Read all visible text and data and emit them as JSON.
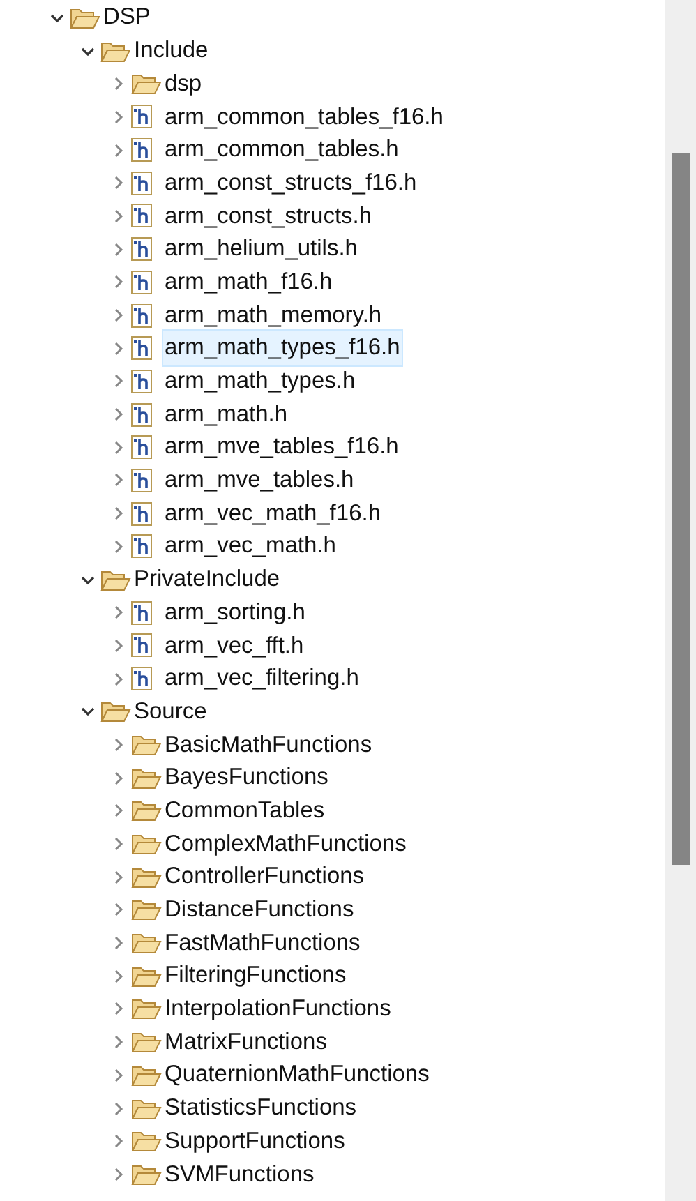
{
  "tree": [
    {
      "label": "DSP",
      "kind": "folder",
      "expanded": true,
      "selected": false,
      "children": [
        {
          "label": "Include",
          "kind": "folder",
          "expanded": true,
          "selected": false,
          "children": [
            {
              "label": "dsp",
              "kind": "folder",
              "expanded": false,
              "selected": false
            },
            {
              "label": "arm_common_tables_f16.h",
              "kind": "header",
              "expanded": false,
              "selected": false
            },
            {
              "label": "arm_common_tables.h",
              "kind": "header",
              "expanded": false,
              "selected": false
            },
            {
              "label": "arm_const_structs_f16.h",
              "kind": "header",
              "expanded": false,
              "selected": false
            },
            {
              "label": "arm_const_structs.h",
              "kind": "header",
              "expanded": false,
              "selected": false
            },
            {
              "label": "arm_helium_utils.h",
              "kind": "header",
              "expanded": false,
              "selected": false
            },
            {
              "label": "arm_math_f16.h",
              "kind": "header",
              "expanded": false,
              "selected": false
            },
            {
              "label": "arm_math_memory.h",
              "kind": "header",
              "expanded": false,
              "selected": false
            },
            {
              "label": "arm_math_types_f16.h",
              "kind": "header",
              "expanded": false,
              "selected": true
            },
            {
              "label": "arm_math_types.h",
              "kind": "header",
              "expanded": false,
              "selected": false
            },
            {
              "label": "arm_math.h",
              "kind": "header",
              "expanded": false,
              "selected": false
            },
            {
              "label": "arm_mve_tables_f16.h",
              "kind": "header",
              "expanded": false,
              "selected": false
            },
            {
              "label": "arm_mve_tables.h",
              "kind": "header",
              "expanded": false,
              "selected": false
            },
            {
              "label": "arm_vec_math_f16.h",
              "kind": "header",
              "expanded": false,
              "selected": false
            },
            {
              "label": "arm_vec_math.h",
              "kind": "header",
              "expanded": false,
              "selected": false
            }
          ]
        },
        {
          "label": "PrivateInclude",
          "kind": "folder",
          "expanded": true,
          "selected": false,
          "children": [
            {
              "label": "arm_sorting.h",
              "kind": "header",
              "expanded": false,
              "selected": false
            },
            {
              "label": "arm_vec_fft.h",
              "kind": "header",
              "expanded": false,
              "selected": false
            },
            {
              "label": "arm_vec_filtering.h",
              "kind": "header",
              "expanded": false,
              "selected": false
            }
          ]
        },
        {
          "label": "Source",
          "kind": "folder",
          "expanded": true,
          "selected": false,
          "children": [
            {
              "label": "BasicMathFunctions",
              "kind": "folder",
              "expanded": false,
              "selected": false
            },
            {
              "label": "BayesFunctions",
              "kind": "folder",
              "expanded": false,
              "selected": false
            },
            {
              "label": "CommonTables",
              "kind": "folder",
              "expanded": false,
              "selected": false
            },
            {
              "label": "ComplexMathFunctions",
              "kind": "folder",
              "expanded": false,
              "selected": false
            },
            {
              "label": "ControllerFunctions",
              "kind": "folder",
              "expanded": false,
              "selected": false
            },
            {
              "label": "DistanceFunctions",
              "kind": "folder",
              "expanded": false,
              "selected": false
            },
            {
              "label": "FastMathFunctions",
              "kind": "folder",
              "expanded": false,
              "selected": false
            },
            {
              "label": "FilteringFunctions",
              "kind": "folder",
              "expanded": false,
              "selected": false
            },
            {
              "label": "InterpolationFunctions",
              "kind": "folder",
              "expanded": false,
              "selected": false
            },
            {
              "label": "MatrixFunctions",
              "kind": "folder",
              "expanded": false,
              "selected": false
            },
            {
              "label": "QuaternionMathFunctions",
              "kind": "folder",
              "expanded": false,
              "selected": false
            },
            {
              "label": "StatisticsFunctions",
              "kind": "folder",
              "expanded": false,
              "selected": false
            },
            {
              "label": "SupportFunctions",
              "kind": "folder",
              "expanded": false,
              "selected": false
            },
            {
              "label": "SVMFunctions",
              "kind": "folder",
              "expanded": false,
              "selected": false
            }
          ]
        }
      ]
    }
  ]
}
